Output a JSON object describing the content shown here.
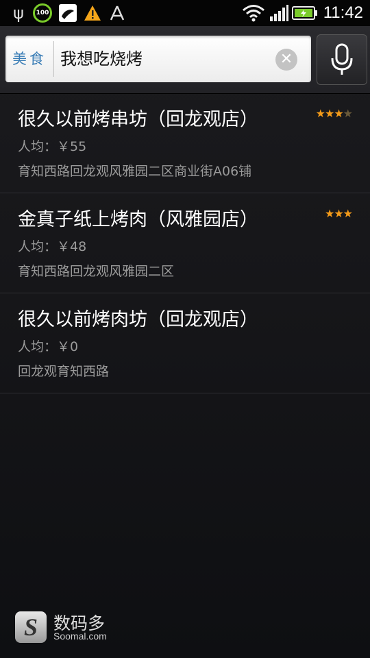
{
  "status_bar": {
    "battery_percent_label": "100",
    "time": "11:42",
    "icons": [
      "usb-icon",
      "battery-saver-icon",
      "app-notification-icon",
      "warning-icon",
      "antenna-icon",
      "wifi-icon",
      "signal-icon",
      "battery-charging-icon"
    ]
  },
  "search": {
    "category": "美食",
    "query": "我想吃烧烤",
    "clear_icon": "clear-icon",
    "mic_icon": "microphone-icon"
  },
  "results": [
    {
      "name": "很久以前烤串坊（回龙观店）",
      "price": "人均：￥55",
      "address": "育知西路回龙观风雅园二区商业街A06铺",
      "rating_stars": 3.5
    },
    {
      "name": "金真子纸上烤肉（风雅园店）",
      "price": "人均：￥48",
      "address": "育知西路回龙观风雅园二区",
      "rating_stars": 3
    },
    {
      "name": "很久以前烤肉坊（回龙观店）",
      "price": "人均：￥0",
      "address": "回龙观育知西路",
      "rating_stars": 0
    }
  ],
  "watermark": {
    "logo_letter": "S",
    "title": "数码多",
    "subtitle": "Soomal.com"
  },
  "colors": {
    "category_blue": "#3a7db6",
    "star_orange": "#f39b1a",
    "battery_green": "#7acb2a"
  }
}
